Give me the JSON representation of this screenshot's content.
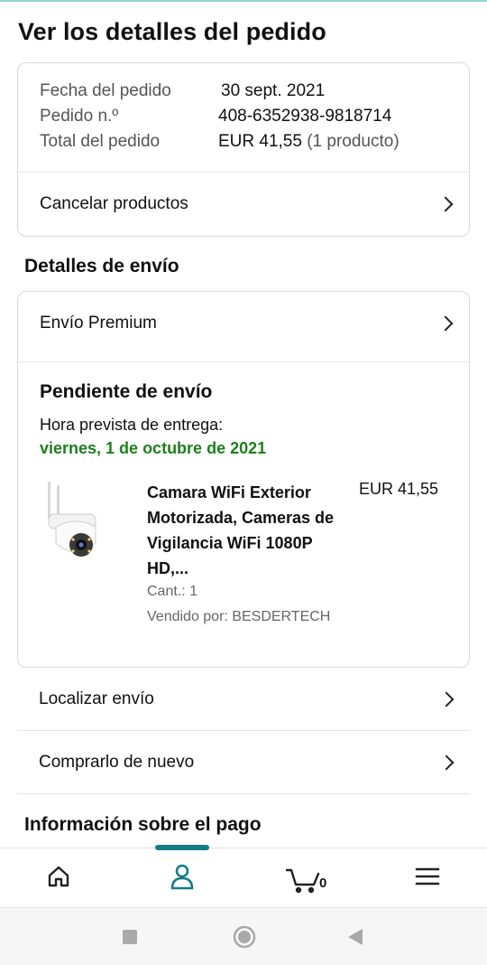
{
  "page": {
    "title": "Ver los detalles del pedido"
  },
  "summary": {
    "date_label": "Fecha del pedido",
    "date_value": "30 sept. 2021",
    "order_label": "Pedido n.º",
    "order_value": "408-6352938-9818714",
    "total_label": "Total del pedido",
    "total_value": "EUR 41,55",
    "total_count": "(1 producto)",
    "cancel_label": "Cancelar productos"
  },
  "shipping": {
    "section_title": "Detalles de envío",
    "method_label": "Envío Premium",
    "status_title": "Pendiente de envío",
    "eta_label": "Hora prevista de entrega:",
    "eta_date": "viernes, 1 de octubre de 2021",
    "eta_color": "#1e7f1e",
    "product": {
      "name": "Camara WiFi Exterior Motorizada, Cameras de Vigilancia WiFi 1080P HD,...",
      "price": "EUR 41,55",
      "quantity": "Cant.: 1",
      "seller": "Vendido por: BESDERTECH",
      "image_icon": "security-camera-icon"
    }
  },
  "actions": {
    "track_label": "Localizar envío",
    "buy_again_label": "Comprarlo de nuevo"
  },
  "payment": {
    "section_title": "Información sobre el pago"
  },
  "bottom_nav": {
    "items": [
      {
        "icon": "home-icon",
        "active": false
      },
      {
        "icon": "person-icon",
        "active": true
      },
      {
        "icon": "cart-icon",
        "count": "0",
        "active": false
      },
      {
        "icon": "menu-icon",
        "active": false
      }
    ],
    "accent_color": "#137d86"
  },
  "system_nav": {
    "items": [
      "recent-apps-icon",
      "home-circle-icon",
      "back-icon"
    ]
  }
}
